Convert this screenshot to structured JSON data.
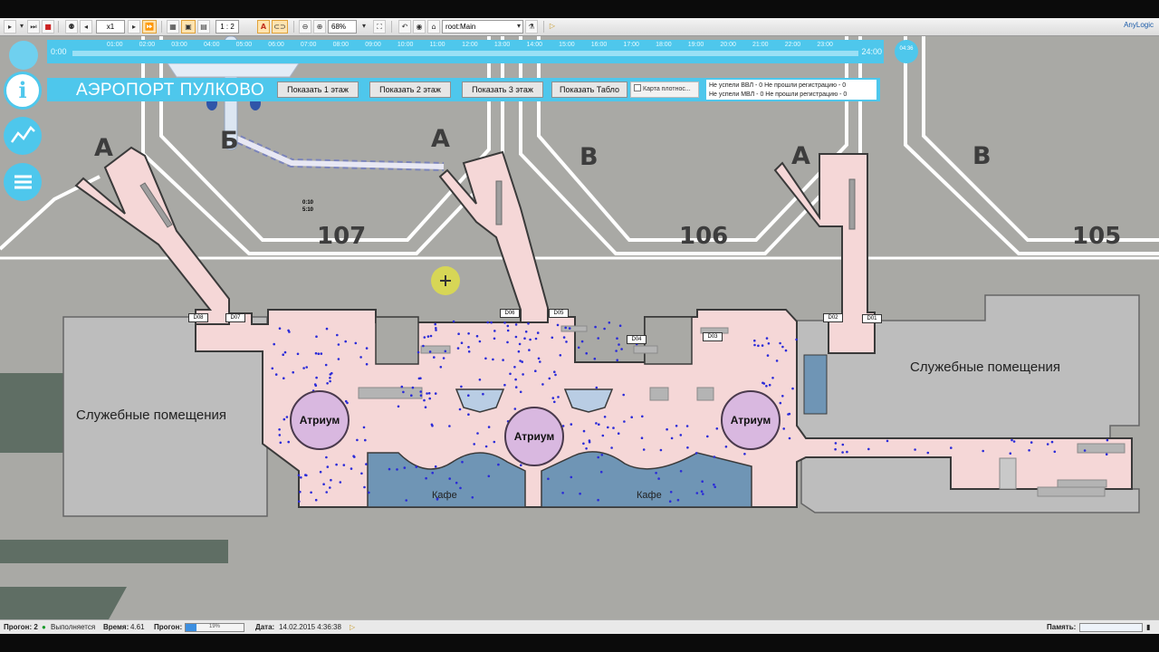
{
  "toolbar": {
    "speed_value": "x1",
    "scale_value": "1 : 2",
    "zoom_value": "68%",
    "agent_select": "root:Main",
    "brand": "AnyLogic"
  },
  "timebar": {
    "start": "0:00",
    "end": "24:00",
    "hours": [
      "01:00",
      "02:00",
      "03:00",
      "04:00",
      "05:00",
      "06:00",
      "07:00",
      "08:00",
      "09:00",
      "10:00",
      "11:00",
      "12:00",
      "13:00",
      "14:00",
      "15:00",
      "16:00",
      "17:00",
      "18:00",
      "19:00",
      "20:00",
      "21:00",
      "22:00",
      "23:00"
    ],
    "clock": "04:36"
  },
  "header": {
    "title": "АЭРОПОРТ ПУЛКОВО",
    "buttons": [
      "Показать 1 этаж",
      "Показать 2 этаж",
      "Показать 3 этаж",
      "Показать Табло"
    ],
    "density_label": "Карта плотнос...",
    "status_line1": "Не успели ВВЛ - 0 Не прошли регистрацию - 0",
    "status_line2": "Не успели МВЛ - 0 Не прошли регистрацию - 0"
  },
  "sidebar": {
    "icons": [
      "info-icon",
      "chart-icon",
      "list-icon"
    ],
    "info_glyph": "i"
  },
  "map": {
    "gate_letters": [
      "A",
      "Б",
      "A",
      "B",
      "A",
      "B"
    ],
    "stands": [
      "107",
      "106",
      "105"
    ],
    "service_left": "Служебные помещения",
    "service_right": "Служебные помещения",
    "atriums": [
      "Атриум",
      "Атриум",
      "Атриум"
    ],
    "cafes": [
      "Кафе",
      "Кафе"
    ],
    "gate_labels": [
      "D08",
      "D07",
      "D06",
      "D05",
      "D04",
      "D03",
      "D02",
      "D01"
    ],
    "plane_times": [
      "0:10",
      "5:10"
    ]
  },
  "bottombar": {
    "run_label": "Прогон: 2",
    "state": "Выполняется",
    "time_label": "Время:",
    "time_value": "4.61",
    "progress_label": "Прогон:",
    "progress_pct": "19%",
    "progress_fraction": 0.19,
    "date_label": "Дата:",
    "date_value": "14.02.2015 4:36:38",
    "memory_label": "Память:"
  },
  "colors": {
    "accent": "#4ec7ec",
    "terminal": "#f5d7d7",
    "cafe": "#6f95b5",
    "atrium": "#d9b8e0"
  }
}
